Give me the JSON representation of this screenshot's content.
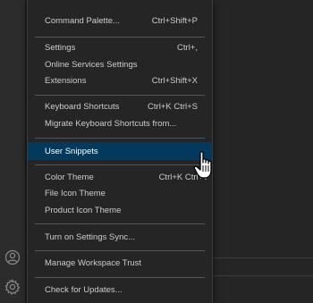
{
  "menu": {
    "items": [
      {
        "label": "Command Palette...",
        "keybinding": "Ctrl+Shift+P"
      },
      {
        "label": "Settings",
        "keybinding": "Ctrl+,"
      },
      {
        "label": "Online Services Settings",
        "keybinding": ""
      },
      {
        "label": "Extensions",
        "keybinding": "Ctrl+Shift+X"
      },
      {
        "label": "Keyboard Shortcuts",
        "keybinding": "Ctrl+K Ctrl+S"
      },
      {
        "label": "Migrate Keyboard Shortcuts from...",
        "keybinding": ""
      },
      {
        "label": "User Snippets",
        "keybinding": ""
      },
      {
        "label": "Color Theme",
        "keybinding": "Ctrl+K Ctrl+T"
      },
      {
        "label": "File Icon Theme",
        "keybinding": ""
      },
      {
        "label": "Product Icon Theme",
        "keybinding": ""
      },
      {
        "label": "Turn on Settings Sync...",
        "keybinding": ""
      },
      {
        "label": "Manage Workspace Trust",
        "keybinding": ""
      },
      {
        "label": "Check for Updates...",
        "keybinding": ""
      }
    ],
    "selected_item": "User Snippets"
  },
  "activity_bar": {
    "icons": [
      "account-icon",
      "manage-gear-icon"
    ]
  },
  "colors": {
    "menu_background": "#252526",
    "selection_background": "#04395e",
    "text": "#cccccc"
  }
}
